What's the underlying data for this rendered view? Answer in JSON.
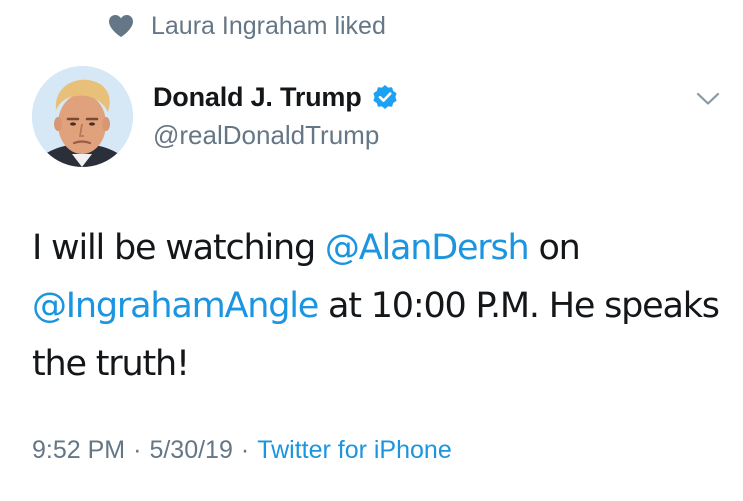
{
  "social_context": {
    "icon": "heart-icon",
    "text": "Laura Ingraham liked"
  },
  "author": {
    "display_name": "Donald J. Trump",
    "handle": "@realDonaldTrump",
    "verified": true,
    "avatar_icon": "avatar-portrait"
  },
  "menu": {
    "icon": "chevron-down-icon"
  },
  "tweet": {
    "segments": [
      {
        "text": "I will be watching ",
        "type": "text"
      },
      {
        "text": "@AlanDersh",
        "type": "mention"
      },
      {
        "text": " on ",
        "type": "text"
      },
      {
        "text": "@IngrahamAngle",
        "type": "mention"
      },
      {
        "text": " at 10:00 P.M. He speaks the truth!",
        "type": "text"
      }
    ]
  },
  "meta": {
    "time": "9:52 PM",
    "separator": "·",
    "date": "5/30/19",
    "source": "Twitter for iPhone"
  },
  "colors": {
    "link": "#1b95e0",
    "secondary_text": "#657786",
    "primary_text": "#14171a",
    "verified_badge": "#1da1f2"
  }
}
